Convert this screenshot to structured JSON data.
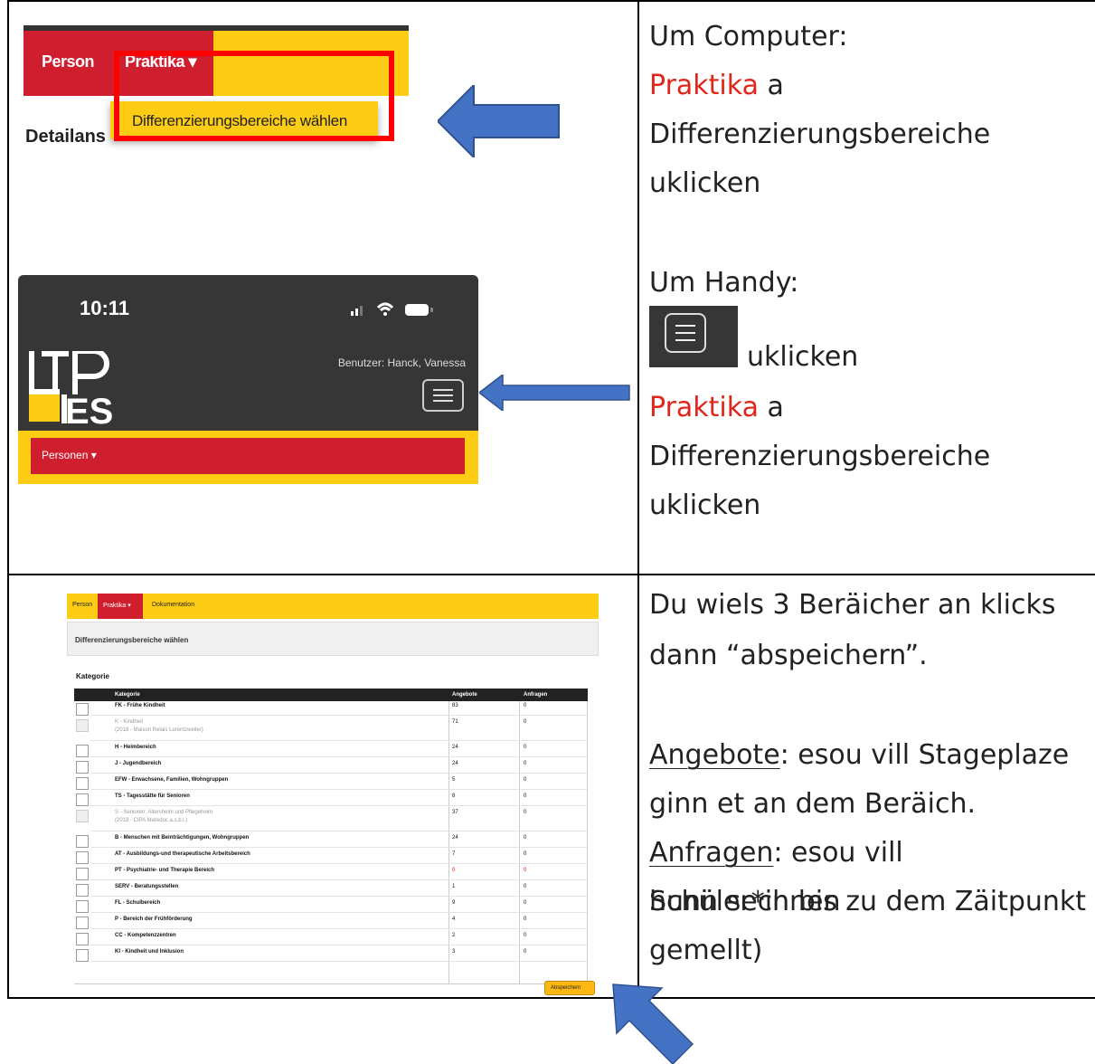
{
  "section1": {
    "screenshot": {
      "nav_person": "Person",
      "nav_praktika": "Praktika ▾",
      "dropdown_item": "Differenzierungsbereiche wählen",
      "heading_partial": "Detailans"
    },
    "text": {
      "line1": "Um Computer:",
      "line2_red": "Praktika",
      "line2_rest": " a",
      "line3": "Differenzierungsbereiche",
      "line4": "uklicken",
      "line5": "Um Handy:",
      "line6": "uklicken",
      "line7_red": "Praktika",
      "line7_rest": " a",
      "line8": "Differenzierungsbereiche",
      "line9": "uklicken"
    },
    "phone": {
      "time": "10:11",
      "user": "Benutzer: Hanck, Vanessa",
      "logo_top": "LTP",
      "logo_bottom": "ES",
      "menu_item": "Personen ▾"
    }
  },
  "section2": {
    "screenshot": {
      "nav": [
        "Person",
        "Praktika ▾",
        "Dokumentation"
      ],
      "panel_title": "Differenzierungsbereiche wählen",
      "kategorie_label": "Kategorie",
      "headers": [
        "Kategorie",
        "Angebote",
        "Anfragen"
      ],
      "rows": [
        {
          "label": "FK - Frühe Kindheit",
          "sub": "",
          "angebote": "83",
          "anfragen": "0",
          "disabled": false
        },
        {
          "label": "K - Kindheit",
          "sub": "(2018 - Maison Relais Lorentzweiler)",
          "angebote": "71",
          "anfragen": "0",
          "disabled": true
        },
        {
          "label": "H - Heimbereich",
          "sub": "",
          "angebote": "24",
          "anfragen": "0",
          "disabled": false
        },
        {
          "label": "J - Jugendbereich",
          "sub": "",
          "angebote": "24",
          "anfragen": "0",
          "disabled": false
        },
        {
          "label": "EFW - Erwachsene, Familien, Wohngruppen",
          "sub": "",
          "angebote": "5",
          "anfragen": "0",
          "disabled": false
        },
        {
          "label": "TS - Tagesstätte für Senioren",
          "sub": "",
          "angebote": "8",
          "anfragen": "0",
          "disabled": false
        },
        {
          "label": "S - Senioren: Altersheim und Pflegeheim",
          "sub": "(2019 - CIPA Maredoc a.s.b.l.)",
          "angebote": "37",
          "anfragen": "0",
          "disabled": true
        },
        {
          "label": "B - Menschen mit Beinträchtigungen, Wohngruppen",
          "sub": "",
          "angebote": "24",
          "anfragen": "0",
          "disabled": false
        },
        {
          "label": "AT - Ausbildungs-und therapeutische Arbeitsbereich",
          "sub": "",
          "angebote": "7",
          "anfragen": "0",
          "disabled": false
        },
        {
          "label": "PT - Psychiatrie- und Therapie Bereich",
          "sub": "",
          "angebote": "0",
          "anfragen": "0",
          "disabled": false
        },
        {
          "label": "SERV - Beratungsstellen",
          "sub": "",
          "angebote": "1",
          "anfragen": "0",
          "disabled": false
        },
        {
          "label": "FL - Schulbereich",
          "sub": "",
          "angebote": "9",
          "anfragen": "0",
          "disabled": false
        },
        {
          "label": "P - Bereich der Frühförderung",
          "sub": "",
          "angebote": "4",
          "anfragen": "0",
          "disabled": false
        },
        {
          "label": "CC - Kompetenzzentren",
          "sub": "",
          "angebote": "2",
          "anfragen": "0",
          "disabled": false
        },
        {
          "label": "KI - Kindheit und Inklusion",
          "sub": "",
          "angebote": "3",
          "anfragen": "0",
          "disabled": false
        }
      ],
      "save_button": "Abspeichern"
    },
    "text": {
      "line1": "Du wiels 3 Beräicher an klicks",
      "line2": "dann “abspeichern”.",
      "angebote_word": "Angebote",
      "angebote_rest": ": esou vill Stageplaze",
      "line4": "ginn et an dem Beräich.",
      "anfragen_word": "Anfragen",
      "anfragen_rest": ": esou vill Schüler*innen",
      "line6": "hunn sech bis zu dem Zäitpunkt",
      "line7": "gemellt)"
    }
  },
  "colors": {
    "yellow": "#fdcd16",
    "red": "#cf1f2e",
    "arrow": "#4472c4",
    "highlight": "#ff0000"
  }
}
